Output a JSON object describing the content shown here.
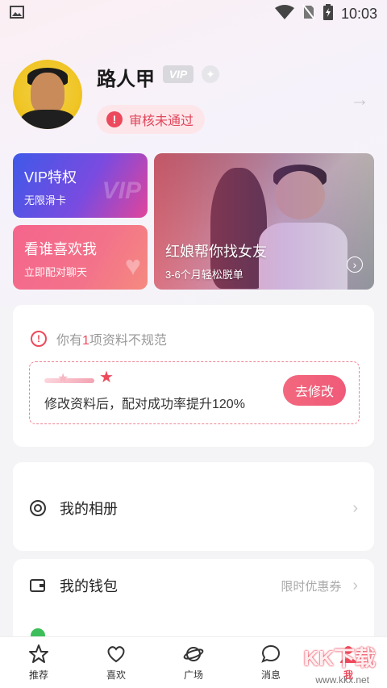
{
  "status_bar": {
    "time": "10:03",
    "icons": [
      "image-icon",
      "wifi-icon",
      "no-sim-icon",
      "battery-charging-icon"
    ]
  },
  "profile": {
    "name": "路人甲",
    "vip_badge": "VIP",
    "review_status": "审核未通过"
  },
  "cards": {
    "vip": {
      "title": "VIP特权",
      "subtitle": "无限滑卡",
      "watermark": "VIP"
    },
    "likes": {
      "title": "看谁喜欢我",
      "subtitle": "立即配对聊天"
    },
    "matchmaker": {
      "title": "红娘帮你找女友",
      "subtitle": "3-6个月轻松脱单"
    }
  },
  "profile_notice": {
    "prefix": "你有",
    "count": "1",
    "suffix": "项资料不规范",
    "tip": "修改资料后，配对成功率提升120%",
    "button": "去修改"
  },
  "menu": {
    "album": {
      "label": "我的相册"
    },
    "wallet": {
      "label": "我的钱包",
      "value": "限时优惠券"
    }
  },
  "tabbar": {
    "items": [
      {
        "label": "推荐",
        "icon": "star-icon"
      },
      {
        "label": "喜欢",
        "icon": "heart-icon"
      },
      {
        "label": "广场",
        "icon": "planet-icon"
      },
      {
        "label": "消息",
        "icon": "chat-icon"
      },
      {
        "label": "我",
        "icon": "person-icon"
      }
    ]
  },
  "watermark": {
    "text": "KK下载",
    "url": "www.kkx.net"
  },
  "colors": {
    "accent": "#ec4a5c",
    "vip_gradient_start": "#3f59e8",
    "likes_gradient_start": "#f5658c"
  }
}
